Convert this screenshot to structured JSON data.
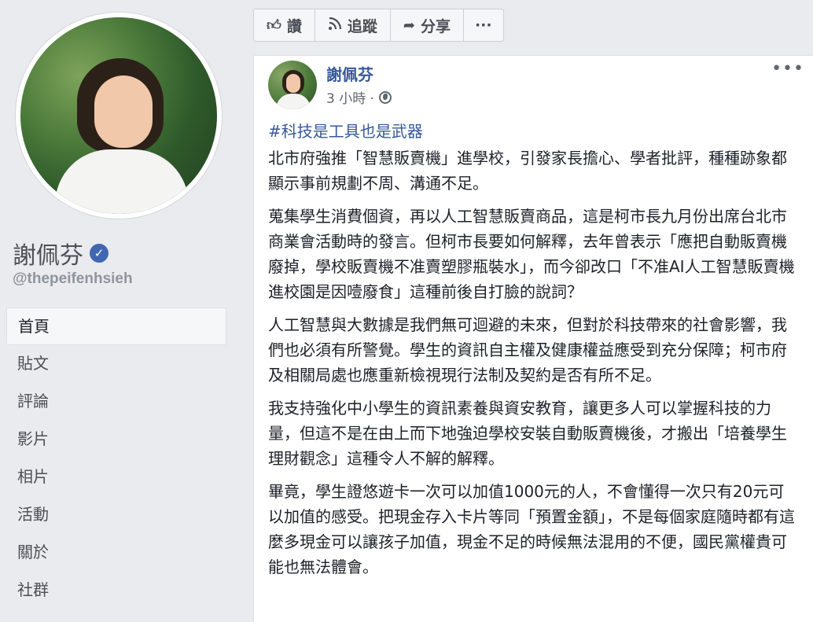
{
  "profile": {
    "name": "謝佩芬",
    "handle": "@thepeifenhsieh"
  },
  "nav": {
    "items": [
      "首頁",
      "貼文",
      "評論",
      "影片",
      "相片",
      "活動",
      "關於",
      "社群"
    ]
  },
  "actions": {
    "like": "讚",
    "follow": "追蹤",
    "share": "分享",
    "more": "···"
  },
  "post": {
    "author": "謝佩芬",
    "time": "3 小時 ·",
    "hashtag": "#科技是工具也是武器",
    "paragraphs": [
      "北市府強推「智慧販賣機」進學校，引發家長擔心、學者批評，種種跡象都顯示事前規劃不周、溝通不足。",
      "蒐集學生消費個資，再以人工智慧販賣商品，這是柯市長九月份出席台北市商業會活動時的發言。但柯市長要如何解釋，去年曾表示「應把自動販賣機廢掉，學校販賣機不准賣塑膠瓶裝水」，而今卻改口「不准AI人工智慧販賣機進校園是因噎廢食」這種前後自打臉的說詞？",
      "人工智慧與大數據是我們無可迴避的未來，但對於科技帶來的社會影響，我們也必須有所警覺。學生的資訊自主權及健康權益應受到充分保障；柯市府及相關局處也應重新檢視現行法制及契約是否有所不足。",
      "我支持強化中小學生的資訊素養與資安教育，讓更多人可以掌握科技的力量，但這不是在由上而下地強迫學校安裝自動販賣機後，才搬出「培養學生理財觀念」這種令人不解的解釋。",
      "畢竟，學生證悠遊卡一次可以加值1000元的人，不會懂得一次只有20元可以加值的感受。把現金存入卡片等同「預置金額」，不是每個家庭隨時都有這麼多現金可以讓孩子加值，現金不足的時候無法混用的不便，國民黨權貴可能也無法體會。"
    ]
  },
  "colors": {
    "link": "#365899",
    "verified": "#4267b2",
    "background": "#e9ebee"
  },
  "icons": [
    "thumbs-up-icon",
    "rss-icon",
    "share-arrow-icon",
    "more-icon",
    "verified-icon",
    "globe-icon",
    "post-more-icon"
  ]
}
